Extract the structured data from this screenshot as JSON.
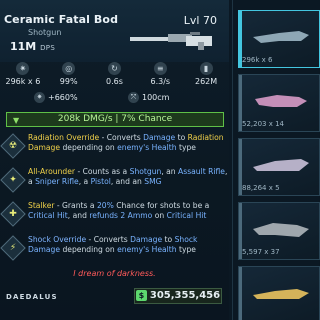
{
  "weapon": {
    "name": "Ceramic Fatal Bod",
    "type": "Shotgun",
    "level": "Lvl 70",
    "dps_value": "11M",
    "dps_unit": "DPS"
  },
  "stats": [
    {
      "icon": "crosshair-icon",
      "glyph": "✷",
      "value": "296k x 6"
    },
    {
      "icon": "accuracy-icon",
      "glyph": "◎",
      "value": "99%"
    },
    {
      "icon": "reload-icon",
      "glyph": "↻",
      "value": "0.6s"
    },
    {
      "icon": "ammo-icon",
      "glyph": "≡",
      "value": "6.3/s"
    },
    {
      "icon": "magazine-icon",
      "glyph": "▮",
      "value": "262M"
    }
  ],
  "extras": {
    "crit": "+660%",
    "range": "100cm"
  },
  "rate_banner": "208k DMG/s | 7% Chance",
  "perks": [
    {
      "glyph": "☢",
      "name": "Radiation Override",
      "text_a": " - Converts ",
      "k1": "Damage",
      "text_b": " to ",
      "k2": "Radiation Damage",
      "text_c": " depending on ",
      "k3": "enemy's Health",
      "text_d": " type"
    },
    {
      "glyph": "✦",
      "name": "All-Arounder",
      "text_a": " - Counts as a ",
      "k1": "Shotgun",
      "text_b": ", an ",
      "k2": "Assault Rifle",
      "text_c": ", a ",
      "k3": "Sniper Rifle",
      "text_d": ", a ",
      "k4": "Pistol",
      "text_e": ", and an ",
      "k5": "SMG"
    },
    {
      "glyph": "✚",
      "name": "Stalker",
      "text_a": " - Grants a ",
      "k1": "20%",
      "text_b": " Chance for shots to be a ",
      "k2": "Critical Hit",
      "text_c": ", and ",
      "k3": "refunds 2 Ammo",
      "text_d": " on ",
      "k4": "Critical Hit"
    },
    {
      "glyph": "⚡",
      "name": "Shock Override",
      "text_a": " - Converts ",
      "k1": "Damage",
      "text_b": " to ",
      "k2": "Shock Damage",
      "text_c": " depending on ",
      "k3": "enemy's Health",
      "text_d": " type"
    }
  ],
  "quote": "I dream of darkness.",
  "brand": "DAEDALUS",
  "price": "305,355,456",
  "currency_glyph": "$",
  "inventory": [
    {
      "caption": "296k x 6",
      "color": "#8ea7b5",
      "selected": true
    },
    {
      "caption": "52,203 x 14",
      "color": "#c48fb8",
      "selected": false
    },
    {
      "caption": "88,264 x 5",
      "color": "#b6b0c7",
      "selected": false
    },
    {
      "caption": "5,597 x 37",
      "color": "#9fa7ad",
      "selected": false
    },
    {
      "caption": "",
      "color": "#d4b35a",
      "selected": false
    }
  ]
}
